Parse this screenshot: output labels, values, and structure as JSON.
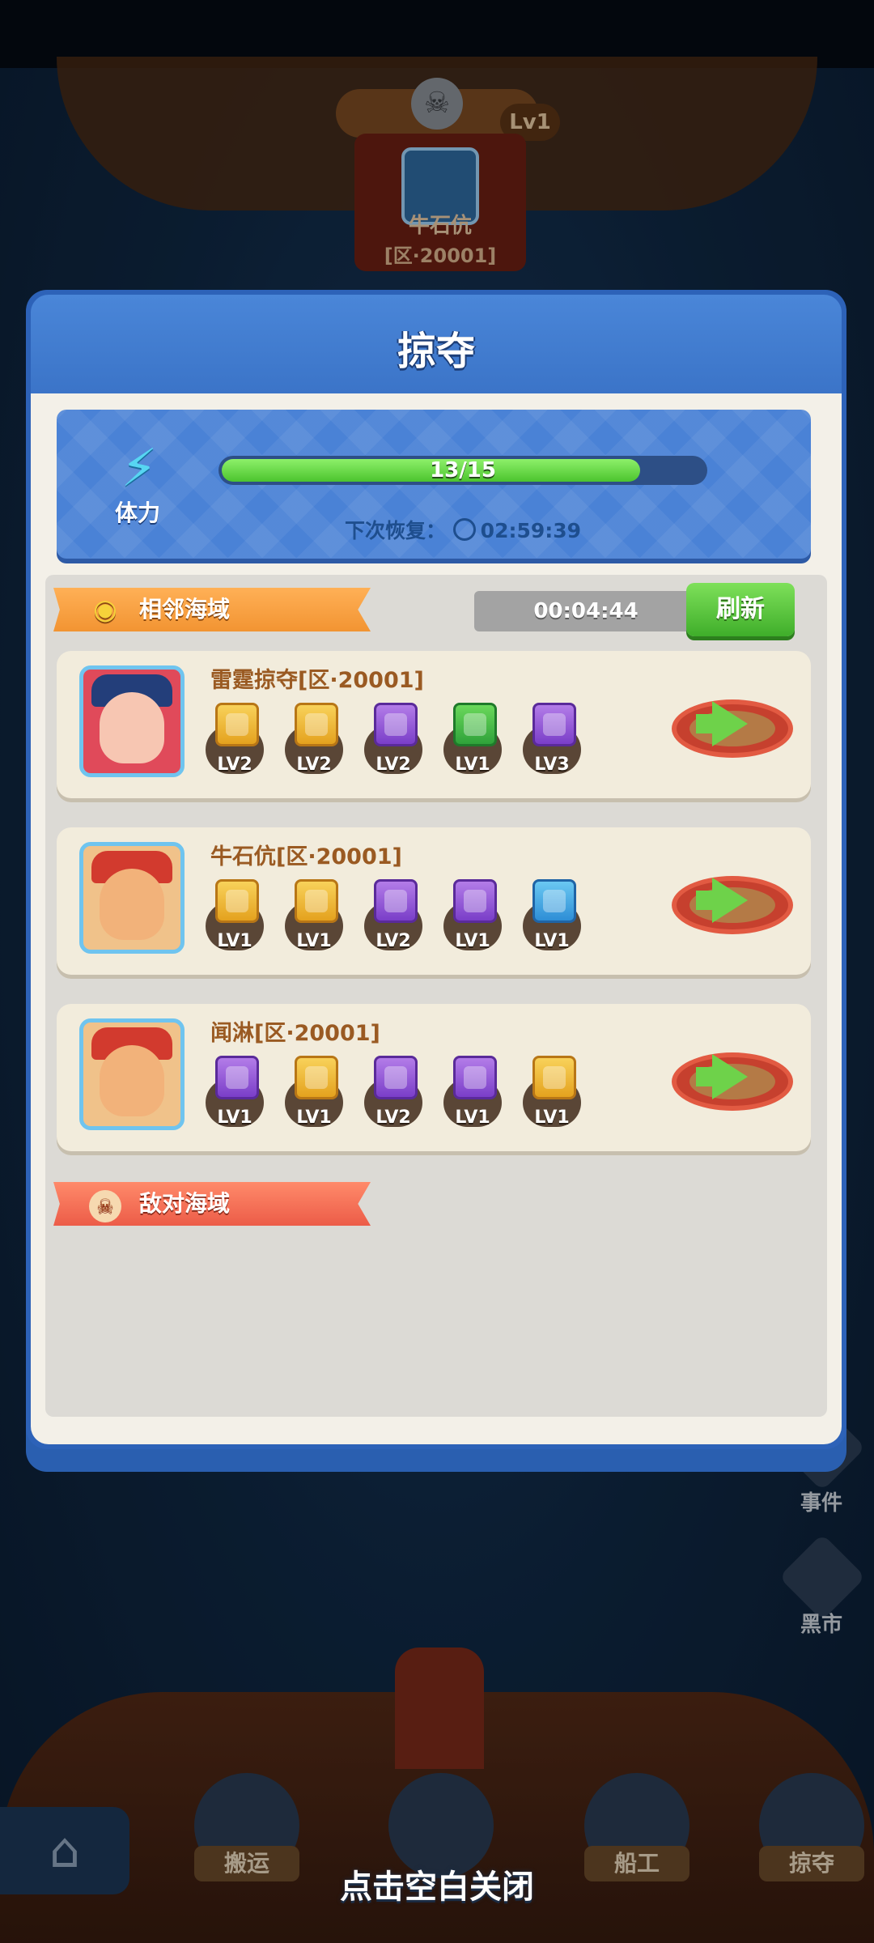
{
  "background": {
    "enemy_level": "Lv1",
    "enemy_name": "牛石伉",
    "enemy_zone": "[区·20001]",
    "side_buttons": [
      {
        "label": "事件",
        "icon": "event-icon"
      },
      {
        "label": "黑市",
        "icon": "shop-icon"
      }
    ],
    "bottom_nav": [
      {
        "label": "搬运",
        "icon": "cargo-icon"
      },
      {
        "label": "",
        "icon": "money-icon"
      },
      {
        "label": "船工",
        "icon": "crew-icon"
      },
      {
        "label": "掠夺",
        "icon": "sword-icon"
      }
    ],
    "close_hint": "点击空白关闭"
  },
  "modal": {
    "title": "掠夺",
    "stamina": {
      "label": "体力",
      "current": 13,
      "max": 15,
      "value_text": "13/15",
      "recover_label": "下次恢复：",
      "recover_time": "02:59:39"
    },
    "nearby": {
      "label": "相邻海域",
      "timer": "00:04:44",
      "refresh_label": "刷新",
      "targets": [
        {
          "name": "雷霆掠夺[区·20001]",
          "avatar": "pirate-girl",
          "resources": [
            {
              "icon": "gold",
              "level": "LV2"
            },
            {
              "icon": "gold",
              "level": "LV2"
            },
            {
              "icon": "purple",
              "level": "LV2"
            },
            {
              "icon": "green",
              "level": "LV1"
            },
            {
              "icon": "purple",
              "level": "LV3"
            }
          ]
        },
        {
          "name": "牛石伉[区·20001]",
          "avatar": "pirate-man",
          "resources": [
            {
              "icon": "gold",
              "level": "LV1"
            },
            {
              "icon": "gold",
              "level": "LV1"
            },
            {
              "icon": "purple",
              "level": "LV2"
            },
            {
              "icon": "purple",
              "level": "LV1"
            },
            {
              "icon": "blue",
              "level": "LV1"
            }
          ]
        },
        {
          "name": "闻淋[区·20001]",
          "avatar": "pirate-man",
          "resources": [
            {
              "icon": "purple",
              "level": "LV1"
            },
            {
              "icon": "gold",
              "level": "LV1"
            },
            {
              "icon": "purple",
              "level": "LV2"
            },
            {
              "icon": "purple",
              "level": "LV1"
            },
            {
              "icon": "gold",
              "level": "LV1"
            }
          ]
        }
      ]
    },
    "hostile": {
      "label": "敌对海域"
    }
  }
}
